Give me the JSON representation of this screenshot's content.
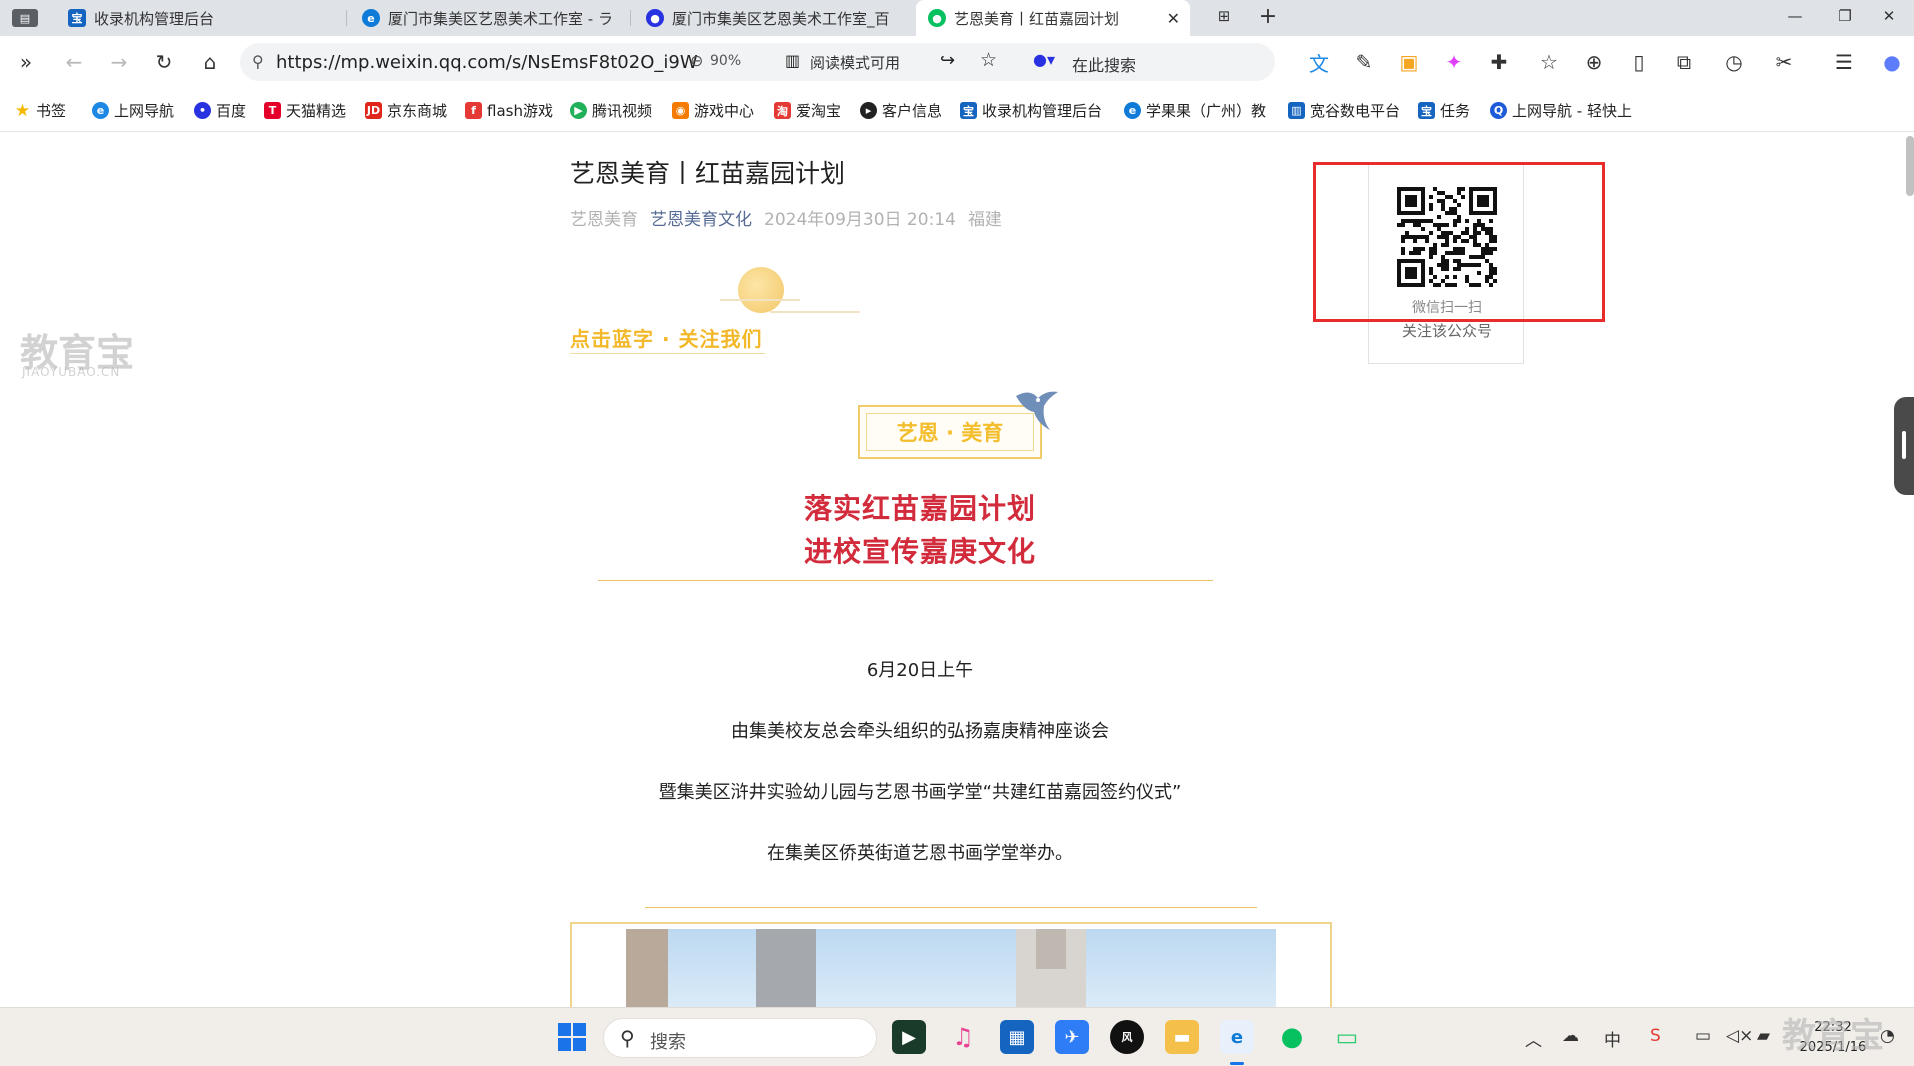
{
  "tabs": [
    {
      "label": "",
      "icon": "sidebar-tab-icon"
    },
    {
      "label": "收录机构管理后台",
      "icon": "site-logo-icon"
    },
    {
      "label": "厦门市集美区艺恩美术工作室 - ラ",
      "icon": "edge-icon"
    },
    {
      "label": "厦门市集美区艺恩美术工作室_百",
      "icon": "baidu-paw-icon"
    },
    {
      "label": "艺恩美育丨红苗嘉园计划",
      "icon": "wechat-icon",
      "active": true
    }
  ],
  "address": {
    "url": "https://mp.weixin.qq.com/s/NsEmsF8t02O_i9W",
    "zoom": "90%",
    "reader_mode": "阅读模式可用",
    "search_placeholder": "在此搜索"
  },
  "bookmarks": [
    {
      "label": "书签",
      "icon": "star-icon",
      "color": "#f5b800"
    },
    {
      "label": "上网导航",
      "icon": "ie-icon",
      "color": "#1e88e5"
    },
    {
      "label": "百度",
      "icon": "baidu-paw-icon",
      "color": "#2932e1"
    },
    {
      "label": "天猫精选",
      "icon": "tmall-icon",
      "color": "#e4002b"
    },
    {
      "label": "京东商城",
      "icon": "jd-icon",
      "color": "#e1251b"
    },
    {
      "label": "flash游戏",
      "icon": "flash-icon",
      "color": "#e53935"
    },
    {
      "label": "腾讯视频",
      "icon": "tencent-video-icon",
      "color": "#20b15a"
    },
    {
      "label": "游戏中心",
      "icon": "game-pad-icon",
      "color": "#f57c00"
    },
    {
      "label": "爱淘宝",
      "icon": "taobao-icon",
      "color": "#e53935"
    },
    {
      "label": "客户信息",
      "icon": "circle-play-icon",
      "color": "#222222"
    },
    {
      "label": "收录机构管理后台",
      "icon": "site-logo-icon",
      "color": "#1565c0"
    },
    {
      "label": "学果果（广州）教",
      "icon": "edge-icon",
      "color": "#0f7bd8"
    },
    {
      "label": "宽谷数电平台",
      "icon": "chart-icon",
      "color": "#1565c0"
    },
    {
      "label": "任务",
      "icon": "site-logo-icon",
      "color": "#1565c0"
    },
    {
      "label": "上网导航 - 轻快上",
      "icon": "search-q-icon",
      "color": "#1e5bd8"
    }
  ],
  "article": {
    "title": "艺恩美育丨红苗嘉园计划",
    "author": "艺恩美育",
    "account": "艺恩美育文化",
    "date": "2024年09月30日 20:14",
    "location": "福建",
    "follow_text": "点击蓝字 · 关注我们",
    "badge": "艺恩 · 美育",
    "headline_1": "落实红苗嘉园计划",
    "headline_2": "进校宣传嘉庚文化",
    "paragraphs": [
      "6月20日上午",
      "由集美校友总会牵头组织的弘扬嘉庚精神座谈会",
      "暨集美区浒井实验幼儿园与艺恩书画学堂“共建红苗嘉园签约仪式”",
      "在集美区侨英街道艺恩书画学堂举办。"
    ]
  },
  "qr": {
    "line1": "微信扫一扫",
    "line2": "关注该公众号"
  },
  "watermark": {
    "main": "教育宝",
    "sub": "JIAOYUBAO.CN"
  },
  "taskbar": {
    "search": "搜索",
    "time": "22:32",
    "date": "2025/1/16",
    "ime": "中"
  },
  "colors": {
    "headline": "#d22b3b",
    "follow": "#f2b829",
    "highlight_box": "#e82c2c",
    "account_link": "#576b95"
  }
}
